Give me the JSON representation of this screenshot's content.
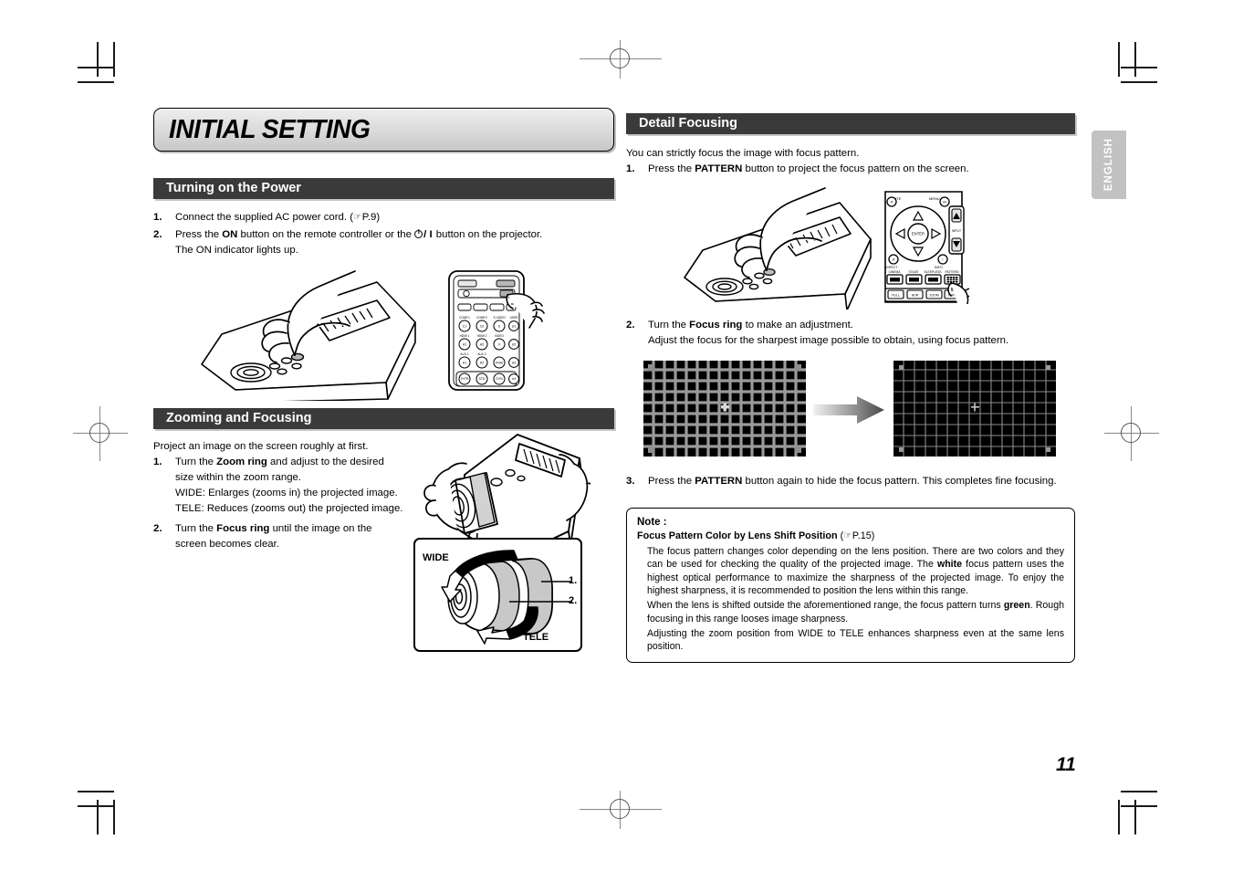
{
  "document": {
    "chapter_title": "INITIAL SETTING",
    "page_number": "11",
    "language_tab": "ENGLISH"
  },
  "left_column": {
    "section_power": {
      "heading": "Turning on the Power",
      "steps": [
        {
          "num": "1.",
          "text_before": "Connect the supplied AC power cord. (",
          "ref": "P.9",
          "text_after": ")"
        },
        {
          "num": "2.",
          "text_a": "Press the ",
          "bold_a": "ON",
          "text_b": " button on the remote controller or the ",
          "bold_b": "/ I",
          "text_c": " button on the projector.",
          "sub": "The ON indicator lights up."
        }
      ]
    },
    "section_zoom": {
      "heading": "Zooming and Focusing",
      "intro": "Project an image on the screen roughly at first.",
      "steps": [
        {
          "num": "1.",
          "text_a": "Turn the ",
          "bold_a": "Zoom ring",
          "text_b": " and adjust to the desired size within the zoom range.",
          "sub1": "WIDE: Enlarges (zooms in) the projected image.",
          "sub2": "TELE: Reduces (zooms out) the projected image."
        },
        {
          "num": "2.",
          "text_a": "Turn the ",
          "bold_a": "Focus ring",
          "text_b": " until the image on the screen becomes clear."
        }
      ],
      "lens_figure": {
        "label_wide": "WIDE",
        "label_tele": "TELE",
        "callout_1": "1.",
        "callout_2": "2."
      }
    }
  },
  "right_column": {
    "section_detail": {
      "heading": "Detail Focusing",
      "intro": "You can strictly focus the image with focus pattern.",
      "step1": {
        "num": "1.",
        "text_a": "Press the ",
        "bold_a": "PATTERN",
        "text_b": " button to project the focus pattern on the screen."
      },
      "step2": {
        "num": "2.",
        "text_a": "Turn the ",
        "bold_a": "Focus ring",
        "text_b": " to make an adjustment.",
        "sub": "Adjust the focus for the sharpest image possible to obtain, using focus pattern."
      },
      "step3": {
        "num": "3.",
        "text_a": "Press the ",
        "bold_a": "PATTERN",
        "text_b": " button again to hide the focus pattern. This completes fine focusing."
      }
    },
    "note": {
      "title": "Note :",
      "subtitle_bold": "Focus Pattern Color by Lens Shift Position",
      "subtitle_ref": "P.15",
      "p1_a": "The focus pattern changes color depending on the lens position. There are two colors and they can be used for checking the quality of the projected image. The ",
      "p1_bold": "white",
      "p1_b": " focus pattern uses the highest optical performance to maximize the sharpness of the projected image. To enjoy the highest sharpness, it is recommended to position the lens within this range.",
      "p2_a": "When the lens is shifted outside the aforementioned range, the focus pattern turns ",
      "p2_bold": "green",
      "p2_b": ". Rough focusing in this range looses image sharpness.",
      "p3": "Adjusting the zoom position from WIDE to TELE enhances sharpness even at the same lens position."
    },
    "remote_buttons": {
      "mute": "MUTE",
      "menu": "MENU",
      "enter": "ENTER",
      "aspect": "ASPECT",
      "info": "INFO.",
      "input": "INPUT",
      "cinema": "CINEMA",
      "stage": "STAGE",
      "sleepless": "SLEEPLESS",
      "pattern": "PATTERN",
      "full": "FULL",
      "norm": "NOR",
      "zoom": "ZOOM",
      "thru": "THRU"
    }
  },
  "colors": {
    "section_bar": "#3a3a3a",
    "title_bar": "#dcdcdc",
    "lang_tab": "#c2c2c2",
    "pattern_bg": "#000000",
    "pattern_line": "#9a9a9a"
  }
}
